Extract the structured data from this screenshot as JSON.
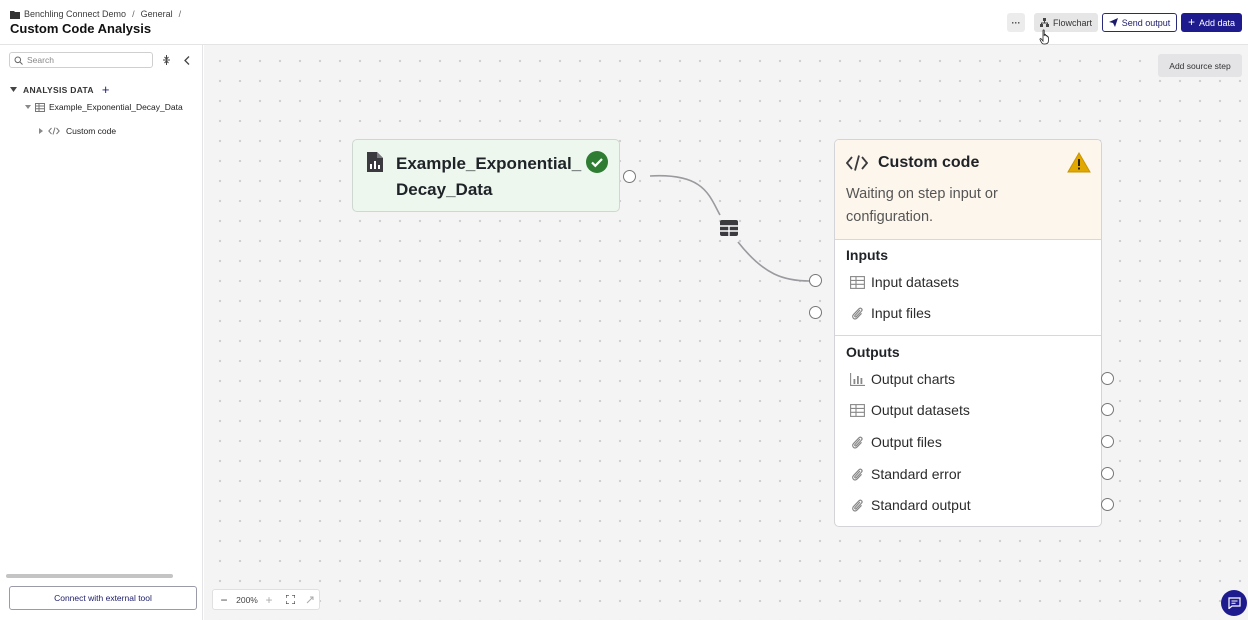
{
  "header": {
    "breadcrumb": [
      "Benchling Connect Demo",
      "General"
    ],
    "title": "Custom Code Analysis",
    "more_label": "···",
    "flowchart_label": "Flowchart",
    "send_output_label": "Send output",
    "add_data_label": "Add data"
  },
  "sidebar": {
    "search_placeholder": "Search",
    "section_label": "ANALYSIS DATA",
    "items": [
      {
        "label": "Example_Exponential_Decay_Data",
        "icon": "table-icon"
      },
      {
        "label": "Custom code",
        "icon": "code-icon"
      }
    ],
    "connect_label": "Connect with external tool"
  },
  "canvas": {
    "add_source_label": "Add source step",
    "source_node": {
      "title": "Example_Exponential_Decay_Data",
      "status": "success"
    },
    "custom_code_node": {
      "title": "Custom code",
      "description": "Waiting on step input or configuration.",
      "inputs_label": "Inputs",
      "inputs": [
        "Input datasets",
        "Input files"
      ],
      "outputs_label": "Outputs",
      "outputs": [
        "Output charts",
        "Output datasets",
        "Output files",
        "Standard error",
        "Standard output"
      ]
    },
    "zoom_level": "200%"
  },
  "colors": {
    "accent": "#1e1b8f",
    "success": "#2e7d32",
    "warning": "#e0a800"
  }
}
